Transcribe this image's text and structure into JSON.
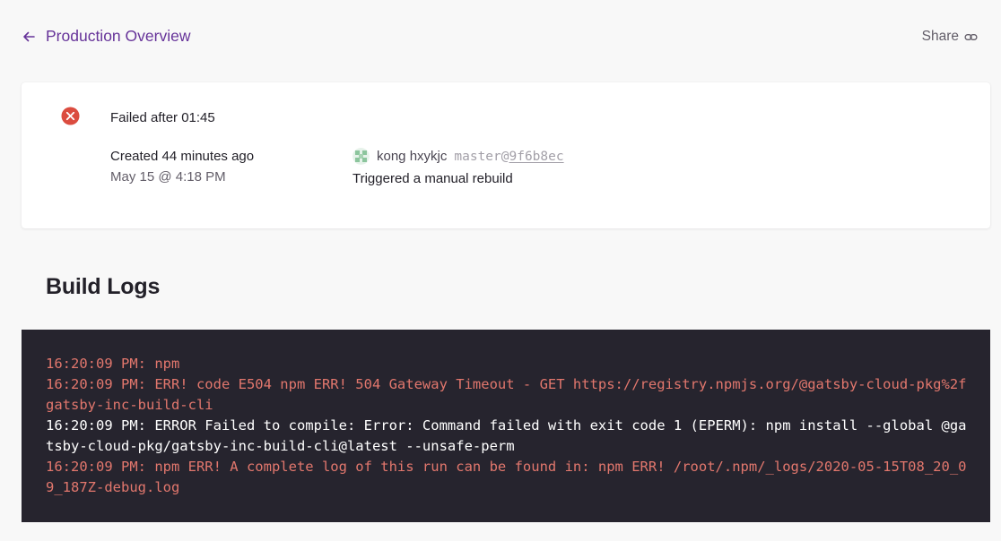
{
  "nav": {
    "back_label": "Production Overview",
    "share_label": "Share"
  },
  "build": {
    "status": "Failed after 01:45",
    "created": "Created 44 minutes ago",
    "created_date": "May 15 @ 4:18 PM",
    "author": "kong hxykjc",
    "branch": "master@",
    "commit_sha": "9f6b8ec",
    "trigger": "Triggered a manual rebuild"
  },
  "logs": {
    "title": "Build Logs",
    "lines": [
      {
        "level": "err",
        "text": "16:20:09 PM: npm"
      },
      {
        "level": "err",
        "text": "16:20:09 PM: ERR! code E504 npm ERR! 504 Gateway Timeout - GET https://registry.npmjs.org/@gatsby-cloud-pkg%2fgatsby-inc-build-cli"
      },
      {
        "level": "info",
        "text": "16:20:09 PM: ERROR Failed to compile: Error: Command failed with exit code 1 (EPERM): npm install --global @gatsby-cloud-pkg/gatsby-inc-build-cli@latest --unsafe-perm"
      },
      {
        "level": "err",
        "text": "16:20:09 PM: npm ERR! A complete log of this run can be found in: npm ERR! /root/.npm/_logs/2020-05-15T08_20_09_187Z-debug.log"
      }
    ]
  },
  "colors": {
    "brand": "#663399",
    "error": "#db4c3f",
    "terminal_bg": "#26242e",
    "log_error": "#e2776d"
  }
}
